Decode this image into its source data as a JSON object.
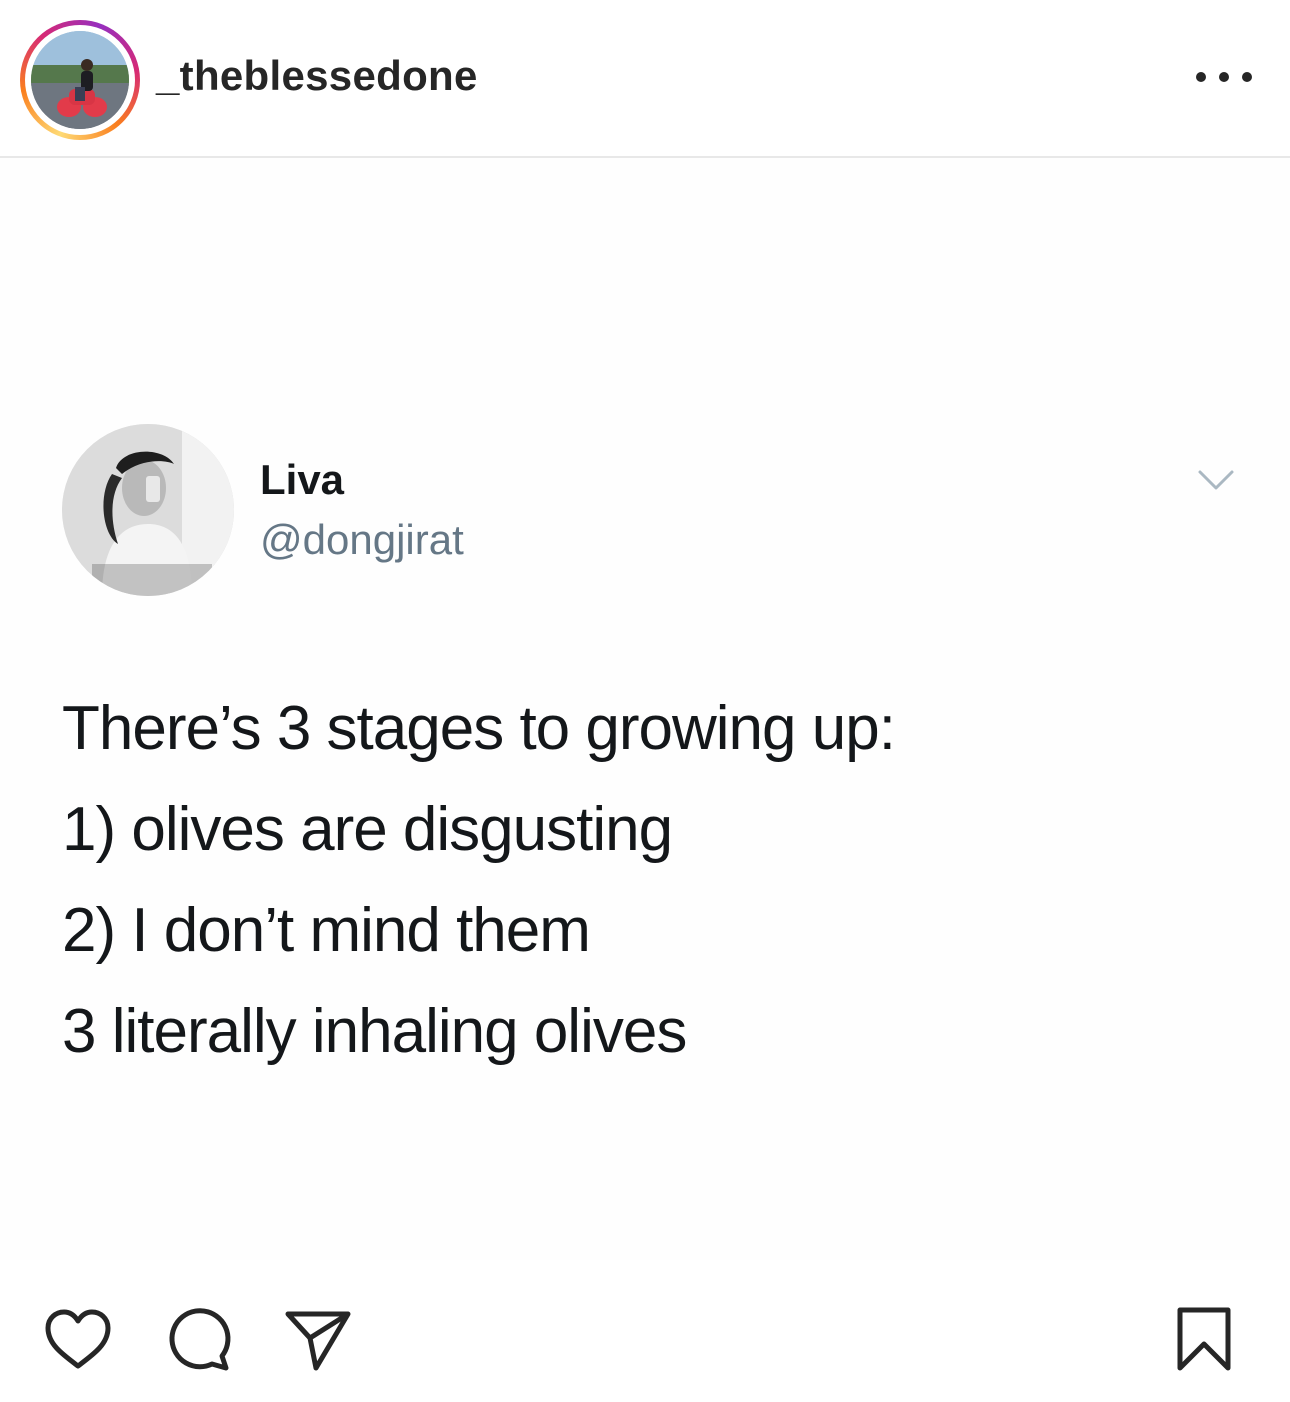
{
  "header": {
    "username": "_theblessedone",
    "avatar_icon": "profile-photo-motorcycle",
    "more_icon": "more-options-icon"
  },
  "tweet": {
    "display_name": "Liva",
    "handle": "@dongjirat",
    "lines": [
      "There’s 3 stages to growing up:",
      "1) olives are disgusting",
      "2) I don’t mind them",
      "3 literally inhaling olives"
    ]
  },
  "actions": {
    "like_icon": "heart-icon",
    "comment_icon": "comment-icon",
    "share_icon": "send-icon",
    "save_icon": "bookmark-icon"
  },
  "colors": {
    "text": "#262626",
    "tweet_text": "#14171a",
    "handle": "#657786",
    "ring_start": "#feda75",
    "ring_end": "#d62976"
  }
}
